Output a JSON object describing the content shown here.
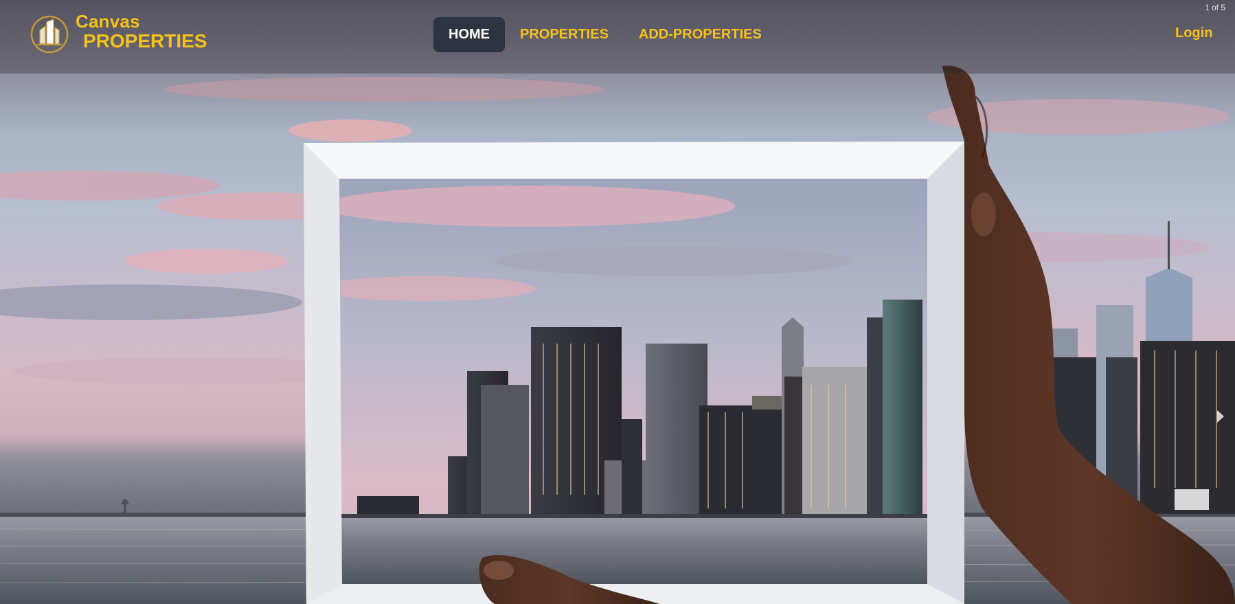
{
  "brand": {
    "name_line1": "Canvas",
    "name_line2": "PROPERTIES",
    "logo_icon": "building-logo-icon",
    "accent_color": "#f6c21a"
  },
  "nav": {
    "items": [
      {
        "label": "HOME",
        "active": true
      },
      {
        "label": "PROPERTIES",
        "active": false
      },
      {
        "label": "ADD-PROPERTIES",
        "active": false
      }
    ]
  },
  "header": {
    "login_label": "Login"
  },
  "carousel": {
    "counter": "1 of 5",
    "next_icon": "chevron-right-icon"
  }
}
